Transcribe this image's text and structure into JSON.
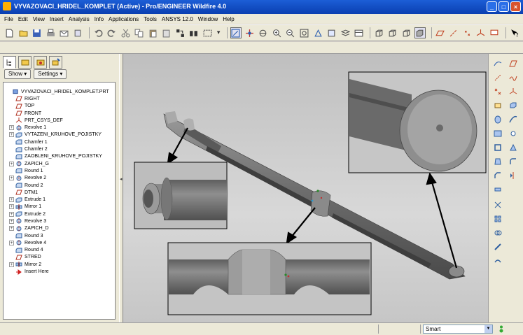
{
  "window": {
    "title": "VYVAZOVACI_HRIDEL_KOMPLET (Active) - Pro/ENGINEER Wildfire 4.0"
  },
  "menu": [
    "File",
    "Edit",
    "View",
    "Insert",
    "Analysis",
    "Info",
    "Applications",
    "Tools",
    "ANSYS 12.0",
    "Window",
    "Help"
  ],
  "toolbar": {
    "icons": [
      "new-icon",
      "open-icon",
      "save-icon",
      "print-icon",
      "email-icon",
      "copy-print-icon",
      "undo-icon",
      "redo-icon",
      "cut-icon",
      "copy-icon",
      "paste-icon",
      "paste-special-icon",
      "regenerate-icon",
      "find-icon",
      "select-box-icon",
      "repaint-icon",
      "spin-center-icon",
      "orient-icon",
      "zoom-in-icon",
      "zoom-out-icon",
      "refit-icon",
      "reorient-icon",
      "saved-views-icon",
      "layers-icon",
      "view-manager-icon",
      "wireframe-icon",
      "hidden-line-icon",
      "no-hidden-icon",
      "shading-icon",
      "datum-planes-icon",
      "datum-axes-icon",
      "datum-points-icon",
      "coordinate-systems-icon",
      "annotations-icon",
      "context-help-icon"
    ]
  },
  "navigator": {
    "tabs": [
      "model-tree-tab",
      "folder-browser-tab",
      "favorites-tab",
      "connections-tab"
    ],
    "show_label": "Show",
    "settings_label": "Settings",
    "tree": [
      {
        "label": "VYVAZOVACI_HRIDEL_KOMPLET.PRT",
        "icon": "part-icon",
        "expand": false,
        "indent": 0
      },
      {
        "label": "RIGHT",
        "icon": "datum-plane-icon",
        "expand": false,
        "indent": 1
      },
      {
        "label": "TOP",
        "icon": "datum-plane-icon",
        "expand": false,
        "indent": 1
      },
      {
        "label": "FRONT",
        "icon": "datum-plane-icon",
        "expand": false,
        "indent": 1
      },
      {
        "label": "PRT_CSYS_DEF",
        "icon": "csys-icon",
        "expand": false,
        "indent": 1
      },
      {
        "label": "Revolve 1",
        "icon": "revolve-icon",
        "expand": true,
        "indent": 1
      },
      {
        "label": "VYTAZENI_KRUHOVE_POJISTKY",
        "icon": "extrude-icon",
        "expand": true,
        "indent": 1
      },
      {
        "label": "Chamfer 1",
        "icon": "chamfer-icon",
        "expand": false,
        "indent": 1
      },
      {
        "label": "Chamfer 2",
        "icon": "chamfer-icon",
        "expand": false,
        "indent": 1
      },
      {
        "label": "ZAOBLENI_KRUHOVE_POJISTKY",
        "icon": "round-icon",
        "expand": false,
        "indent": 1
      },
      {
        "label": "ZAPICH_G",
        "icon": "revolve-icon",
        "expand": true,
        "indent": 1
      },
      {
        "label": "Round 1",
        "icon": "round-icon",
        "expand": false,
        "indent": 1
      },
      {
        "label": "Revolve 2",
        "icon": "revolve-icon",
        "expand": true,
        "indent": 1
      },
      {
        "label": "Round 2",
        "icon": "round-icon",
        "expand": false,
        "indent": 1
      },
      {
        "label": "DTM1",
        "icon": "datum-plane-icon",
        "expand": false,
        "indent": 1
      },
      {
        "label": "Extrude 1",
        "icon": "extrude-icon",
        "expand": true,
        "indent": 1
      },
      {
        "label": "Mirror 1",
        "icon": "mirror-icon",
        "expand": true,
        "indent": 1
      },
      {
        "label": "Extrude 2",
        "icon": "extrude-icon",
        "expand": true,
        "indent": 1
      },
      {
        "label": "Revolve 3",
        "icon": "revolve-icon",
        "expand": true,
        "indent": 1
      },
      {
        "label": "ZAPICH_D",
        "icon": "revolve-icon",
        "expand": true,
        "indent": 1
      },
      {
        "label": "Round 3",
        "icon": "round-icon",
        "expand": false,
        "indent": 1
      },
      {
        "label": "Revolve 4",
        "icon": "revolve-icon",
        "expand": true,
        "indent": 1
      },
      {
        "label": "Round 4",
        "icon": "round-icon",
        "expand": false,
        "indent": 1
      },
      {
        "label": "STRED",
        "icon": "datum-plane-icon",
        "expand": false,
        "indent": 1
      },
      {
        "label": "Mirror 2",
        "icon": "mirror-icon",
        "expand": true,
        "indent": 1
      },
      {
        "label": "Insert Here",
        "icon": "insert-here-icon",
        "expand": false,
        "indent": 1
      }
    ]
  },
  "right_toolbar": {
    "icons": [
      "sketched-curve-icon",
      "datum-plane-tool-icon",
      "datum-axis-tool-icon",
      "curve-icon",
      "datum-point-icon",
      "csys-tool-icon",
      "analysis-icon",
      "extrude-tool-icon",
      "revolve-tool-icon",
      "variable-section-sweep-icon",
      "boundary-blend-icon",
      "hole-icon",
      "shell-icon",
      "rib-icon",
      "draft-icon",
      "round-tool-icon",
      "chamfer-tool-icon",
      "mirror-tool-icon",
      "merge-icon",
      "trim-icon",
      "pattern-icon",
      "intersect-icon",
      "solidify-icon",
      "offset-icon"
    ]
  },
  "status": {
    "filter_value": "Smart"
  },
  "colors": {
    "title_bar": "#0a3fb1",
    "chrome": "#ece9d8",
    "viewport": "#c8c8c8",
    "part": "#7a7a7a"
  }
}
